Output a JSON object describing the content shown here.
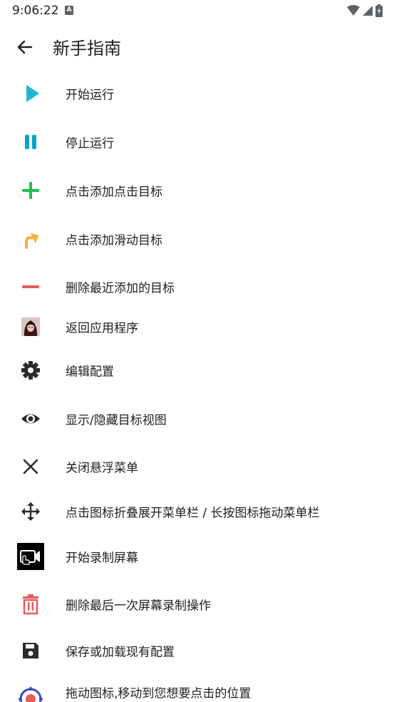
{
  "status_bar": {
    "time": "9:06:22",
    "notification_badge": "A"
  },
  "app_bar": {
    "title": "新手指南"
  },
  "guide_items": [
    {
      "label": "开始运行",
      "icon": "play-icon",
      "color": "#1fb6d6"
    },
    {
      "label": "停止运行",
      "icon": "pause-icon",
      "color": "#00a6c8"
    },
    {
      "label": "点击添加点击目标",
      "icon": "plus-icon",
      "color": "#1ec04c"
    },
    {
      "label": "点击添加滑动目标",
      "icon": "swipe-arrow-icon",
      "color": "#f5b13c"
    },
    {
      "label": "删除最近添加的目标",
      "icon": "minus-icon",
      "color": "#e35b5b"
    },
    {
      "label": "返回应用程序",
      "icon": "app-avatar-icon",
      "color": "#6b2f2f"
    },
    {
      "label": "编辑配置",
      "icon": "gear-icon",
      "color": "#2b2b2b"
    },
    {
      "label": "显示/隐藏目标视图",
      "icon": "eye-icon",
      "color": "#2b2b2b"
    },
    {
      "label": "关闭悬浮菜单",
      "icon": "close-icon",
      "color": "#2b2b2b"
    },
    {
      "label": "点击图标折叠展开菜单栏 / 长按图标拖动菜单栏",
      "icon": "move-icon",
      "color": "#2b2b2b"
    },
    {
      "label": "开始录制屏幕",
      "icon": "record-screen-icon",
      "color": "#000000"
    },
    {
      "label": "删除最后一次屏幕录制操作",
      "icon": "trash-icon",
      "color": "#e35b5b"
    },
    {
      "label": "保存或加载现有配置",
      "icon": "save-icon",
      "color": "#2b2b2b"
    },
    {
      "label": "拖动图标,移动到您想要点击的位置",
      "icon": "target-icon",
      "color": "#3b49c4"
    }
  ]
}
